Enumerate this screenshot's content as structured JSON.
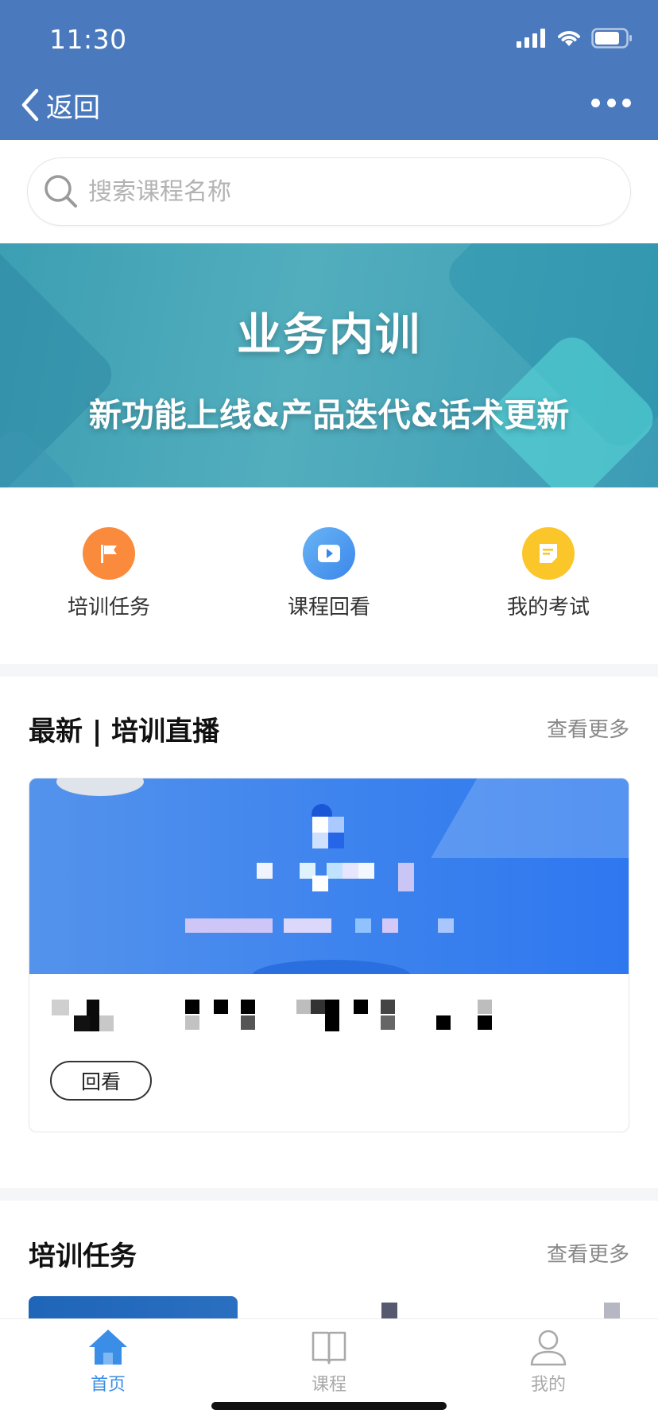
{
  "status_bar": {
    "time": "11:30"
  },
  "nav": {
    "back_label": "返回"
  },
  "search": {
    "placeholder": "搜索课程名称"
  },
  "banner": {
    "title": "业务内训",
    "subtitle": "新功能上线&产品迭代&话术更新"
  },
  "quick_actions": [
    {
      "label": "培训任务",
      "icon": "flag-icon",
      "color": "#fa8a3c"
    },
    {
      "label": "课程回看",
      "icon": "play-icon",
      "color": "#4a9cf0"
    },
    {
      "label": "我的考试",
      "icon": "exam-note-icon",
      "color": "#fbc62a"
    }
  ],
  "live_section": {
    "title": "最新 | 培训直播",
    "more": "查看更多",
    "card": {
      "button_label": "回看"
    }
  },
  "task_section": {
    "title": "培训任务",
    "more": "查看更多"
  },
  "tabbar": {
    "items": [
      {
        "label": "首页",
        "icon": "home-icon",
        "active": true
      },
      {
        "label": "课程",
        "icon": "book-icon",
        "active": false
      },
      {
        "label": "我的",
        "icon": "user-icon",
        "active": false
      }
    ],
    "active_color": "#3a8ee6",
    "inactive_color": "#a9a9a9"
  },
  "colors": {
    "header": "#4a79bd",
    "banner": "#52aebd"
  }
}
